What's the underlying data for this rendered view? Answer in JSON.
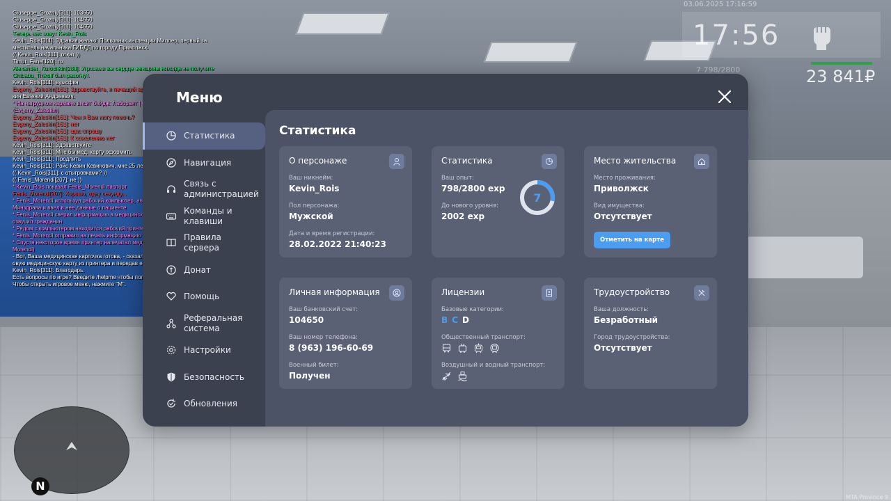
{
  "hud": {
    "date": "03.06.2025 17:16:59",
    "time": "17:56",
    "ammo": "7    798/2800",
    "money": "23 841₽",
    "health_color": "#2fa14a"
  },
  "watermark": "MTA Province 9",
  "minimap": {
    "north": "N"
  },
  "chat": [
    {
      "text": "Giuseppe_Grozniy[311]: 103650",
      "cls": ""
    },
    {
      "text": "Giuseppe_Grozniy[311]: 104650",
      "cls": ""
    },
    {
      "text": "Giuseppe_Grozniy[311]: 104650",
      "cls": ""
    },
    {
      "text": "Теперь вас зовут Kevin_Rois",
      "cls": "c-green"
    },
    {
      "text": "Kevin_Rois[311]: Здравия желаю! Полковник инспекции Миллер, первый за",
      "cls": ""
    },
    {
      "text": "меститель начальника ГИБДД по городу Приволжск.",
      "cls": ""
    },
    {
      "text": "(( Kevin_Rois[311]: откат ))",
      "cls": ""
    },
    {
      "text": "Timur_Fane[120]: го",
      "cls": ""
    },
    {
      "text": "Alexander_Kurochkin[288]: Угрозами вы сердце женщины никогда не получите",
      "cls": "c-green"
    },
    {
      "text": "Chibabu_Tinkoff был разогнут.",
      "cls": "c-green"
    },
    {
      "text": "Kevin_Rois[311]: ьуысфкя",
      "cls": ""
    },
    {
      "text": "Evgeny_Zaleskin[161]: Здравствуйте, я печащий врач ЦГБ г. Приволжск, Залес",
      "cls": "c-red"
    },
    {
      "text": "кин Евгений Андреевич.",
      "cls": ""
    },
    {
      "text": "* На нагрудном кармане висит бейдж: Лаборант | ОМК | ЦГБ г.П. | Залескин Е.А.",
      "cls": "c-pink"
    },
    {
      "text": "(Evgeny_Zaleskin)",
      "cls": "c-pink"
    },
    {
      "text": "Evgeny_Zaleskin[161]: Чем я Вам могу помочь?",
      "cls": "c-red"
    },
    {
      "text": "Evgeny_Zaleskin[161]: нет",
      "cls": "c-red"
    },
    {
      "text": "Evgeny_Zaleskin[161]: щас спрошу",
      "cls": "c-red"
    },
    {
      "text": "Evgeny_Zaleskin[161]: К сожелению нет",
      "cls": "c-red"
    },
    {
      "text": "Kevin_Rois[311]: Здравствуйте",
      "cls": ""
    },
    {
      "text": "Kevin_Rois[311]: Мне бы мед. карту оформить",
      "cls": ""
    },
    {
      "text": "Kevin_Rois[311]: Продлить",
      "cls": ""
    },
    {
      "text": "Kevin_Rois[311]: Ройс Кевин Кевинович, мне 25 лет",
      "cls": ""
    },
    {
      "text": "(( Kevin_Rois[311]: с отыгровками? ))",
      "cls": ""
    },
    {
      "text": "(( Fenis_Morendi[207]: не ))",
      "cls": ""
    },
    {
      "text": "* Kevin_Rois показал Fenis_Morendi паспорт",
      "cls": "c-pink"
    },
    {
      "text": "Fenis_Morendi[207]: Хорошо, одну секунду...",
      "cls": "c-red"
    },
    {
      "text": "* Fenis_Morendi используя рабочий компьютер, авторизовался в базе данных",
      "cls": "c-pink"
    },
    {
      "text": "Минздрава и ввел в нее данные о пациенте",
      "cls": "c-pink"
    },
    {
      "text": "* Fenis_Morendi сверил информацию в медицинском досье с той, которую",
      "cls": "c-pink"
    },
    {
      "text": "озвучил гражданин",
      "cls": "c-pink"
    },
    {
      "text": "* Рядом с компьютером находится рабочий принтер. (Fenis_Morendi)",
      "cls": "c-pink"
    },
    {
      "text": "* Fenis_Morendi отправил на печать информацию о медицинской карте пациента",
      "cls": "c-pink"
    },
    {
      "text": "* Спустя некоторое время принтер напечатал медицинскую карту. (Fenis_",
      "cls": "c-pink"
    },
    {
      "text": "Morendi)",
      "cls": "c-pink"
    },
    {
      "text": "- Вот, Ваша медицинская карточка готова, - сказал Fenis_Morendi, достав гот",
      "cls": ""
    },
    {
      "text": "овую медицинскую карту из принтера и передав ее пациенту.",
      "cls": ""
    },
    {
      "text": "Kevin_Rois[311]: Благодарь.",
      "cls": ""
    },
    {
      "text": "Есть вопросы по игре? Введите /helpme чтобы получить нужную информацию.",
      "cls": ""
    },
    {
      "text": "Чтобы открыть игровое меню, нажмите \"M\".",
      "cls": ""
    }
  ],
  "menu": {
    "title": "Меню",
    "nav": [
      {
        "label": "Статистика",
        "icon": "pie-chart-icon",
        "active": true
      },
      {
        "label": "Навигация",
        "icon": "compass-icon"
      },
      {
        "label": "Связь с администрацией",
        "icon": "headset-icon"
      },
      {
        "label": "Команды и клавиши",
        "icon": "keyboard-icon"
      },
      {
        "label": "Правила сервера",
        "icon": "book-icon"
      },
      {
        "label": "Донат",
        "icon": "coin-icon"
      },
      {
        "label": "Помощь",
        "icon": "heart-hand-icon"
      },
      {
        "label": "Реферальная система",
        "icon": "referral-icon"
      },
      {
        "label": "Настройки",
        "icon": "gear-icon"
      },
      {
        "label": "Безопасность",
        "icon": "shield-icon"
      },
      {
        "label": "Обновления",
        "icon": "refresh-icon"
      }
    ],
    "content_title": "Статистика",
    "cards": {
      "character": {
        "title": "О персонаже",
        "nick_label": "Ваш никнейм:",
        "nick": "Kevin_Rois",
        "gender_label": "Пол персонажа:",
        "gender": "Мужской",
        "reg_label": "Дата и время регистрации:",
        "reg": "28.02.2022 21:40:23"
      },
      "stats": {
        "title": "Статистика",
        "exp_label": "Ваш опыт:",
        "exp": "798/2800 exp",
        "next_label": "До нового уровня:",
        "next": "2002 exp",
        "level": "7",
        "progress": 0.285
      },
      "residence": {
        "title": "Место жительства",
        "place_label": "Место проживания:",
        "place": "Приволжск",
        "property_label": "Вид имущества:",
        "property": "Отсутствует",
        "map_button": "Отметить на карте"
      },
      "personal": {
        "title": "Личная информация",
        "bank_label": "Ваш банковский счет:",
        "bank": "104650",
        "phone_label": "Ваш номер телефона:",
        "phone": "8 (963) 196-60-69",
        "military_label": "Военный билет:",
        "military": "Получен"
      },
      "licenses": {
        "title": "Лицензии",
        "base_label": "Базовые категории:",
        "categories": [
          {
            "letter": "B",
            "owned": true
          },
          {
            "letter": "C",
            "owned": true
          },
          {
            "letter": "D",
            "owned": false
          }
        ],
        "public_label": "Общественный транспорт:",
        "air_label": "Воздушный и водный транспорт:"
      },
      "job": {
        "title": "Трудоустройство",
        "position_label": "Ваша должность:",
        "position": "Безработный",
        "city_label": "Город трудоустройства:",
        "city": "Отсутствует"
      }
    }
  },
  "colors": {
    "accent": "#4a9df1",
    "panel": "#3c4150",
    "card": "#5b6174"
  }
}
